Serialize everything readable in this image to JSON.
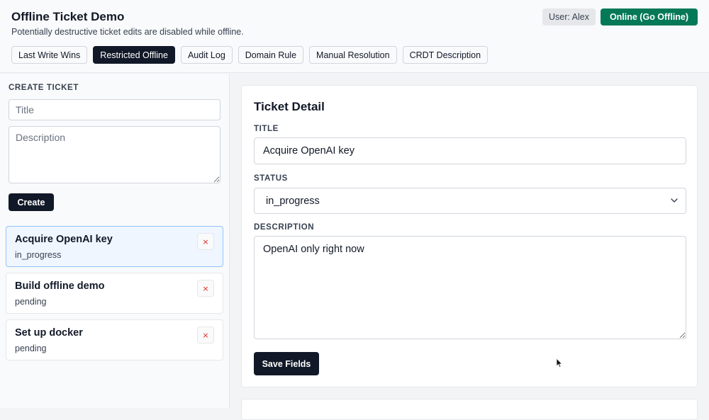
{
  "header": {
    "title": "Offline Ticket Demo",
    "subtitle": "Potentially destructive ticket edits are disabled while offline.",
    "user_label": "User: Alex",
    "online_button": "Online (Go Offline)",
    "tabs": [
      {
        "label": "Last Write Wins",
        "active": false
      },
      {
        "label": "Restricted Offline",
        "active": true
      },
      {
        "label": "Audit Log",
        "active": false
      },
      {
        "label": "Domain Rule",
        "active": false
      },
      {
        "label": "Manual Resolution",
        "active": false
      },
      {
        "label": "CRDT Description",
        "active": false
      }
    ]
  },
  "sidebar": {
    "section_label": "CREATE TICKET",
    "title_placeholder": "Title",
    "description_placeholder": "Description",
    "create_button": "Create",
    "tickets": [
      {
        "title": "Acquire OpenAI key",
        "status": "in_progress",
        "selected": true,
        "delete_icon": "×"
      },
      {
        "title": "Build offline demo",
        "status": "pending",
        "selected": false,
        "delete_icon": "×"
      },
      {
        "title": "Set up docker",
        "status": "pending",
        "selected": false,
        "delete_icon": "×"
      }
    ]
  },
  "detail": {
    "heading": "Ticket Detail",
    "title_label": "TITLE",
    "title_value": "Acquire OpenAI key",
    "status_label": "STATUS",
    "status_value": "in_progress",
    "description_label": "DESCRIPTION",
    "description_value": "OpenAI only right now",
    "save_button": "Save Fields"
  },
  "colors": {
    "online_button_bg": "#047857",
    "active_tab_bg": "#111827",
    "delete_icon": "#dc2626",
    "selected_ticket_bg": "#eff6ff",
    "selected_ticket_border": "#93c5fd"
  },
  "icons": {
    "delete": "close-icon",
    "select": "chevron-down-icon",
    "cursor": "mouse-pointer-icon"
  }
}
